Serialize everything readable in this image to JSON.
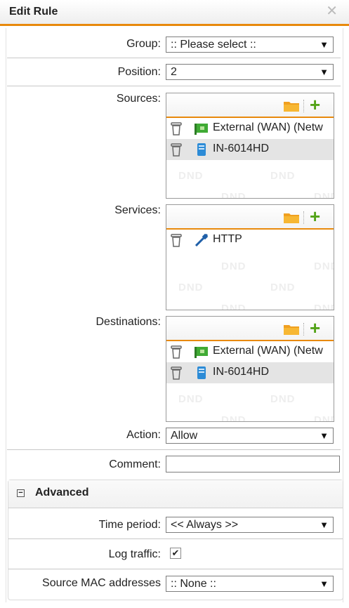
{
  "dialog": {
    "title": "Edit Rule"
  },
  "fields": {
    "group": {
      "label": "Group:",
      "value": ":: Please select ::"
    },
    "position": {
      "label": "Position:",
      "value": "2"
    },
    "sources": {
      "label": "Sources:",
      "items": [
        "External (WAN) (Netw",
        "IN-6014HD"
      ]
    },
    "services": {
      "label": "Services:",
      "items": [
        "HTTP"
      ]
    },
    "destinations": {
      "label": "Destinations:",
      "items": [
        "External (WAN) (Netw",
        "IN-6014HD"
      ]
    },
    "action": {
      "label": "Action:",
      "value": "Allow"
    },
    "comment": {
      "label": "Comment:",
      "value": ""
    }
  },
  "advanced": {
    "title": "Advanced",
    "time_period": {
      "label": "Time period:",
      "value": "<< Always >>"
    },
    "log_traffic": {
      "label": "Log traffic:",
      "checked": true
    },
    "source_mac": {
      "label": "Source MAC addresses",
      "value": ":: None ::"
    }
  },
  "dnd_text": "DND",
  "colors": {
    "accent": "#e8890c",
    "add_green": "#53a318"
  }
}
